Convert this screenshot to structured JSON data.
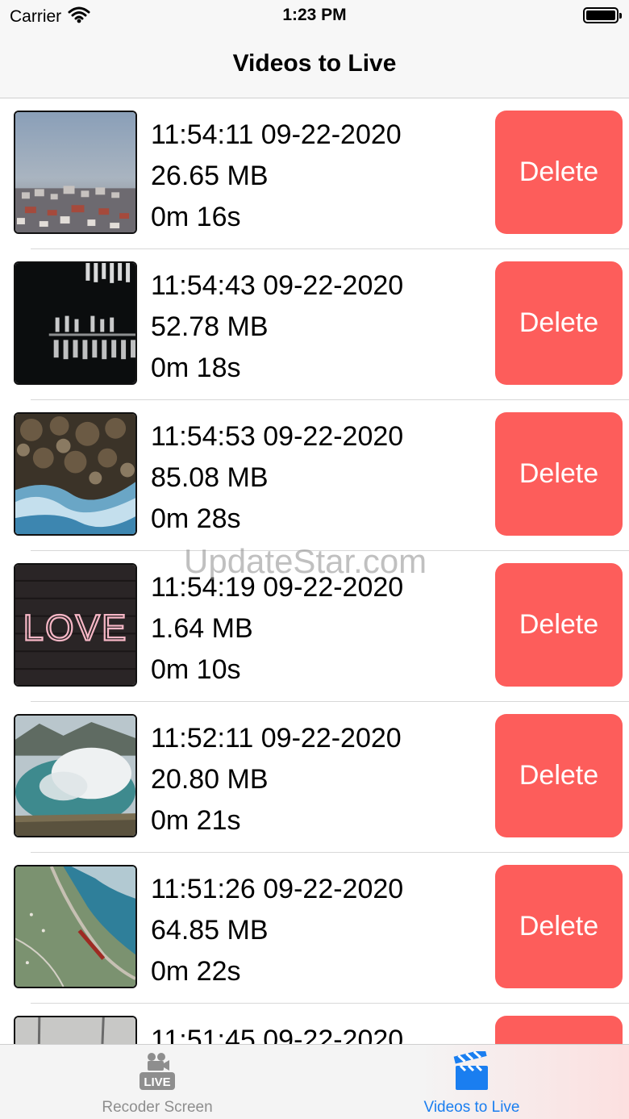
{
  "status": {
    "carrier": "Carrier",
    "time": "1:23 PM",
    "icons": [
      "wifi-icon",
      "battery-icon"
    ]
  },
  "nav": {
    "title": "Videos to Live"
  },
  "videos": [
    {
      "datetime": "11:54:11 09-22-2020",
      "size": "26.65 MB",
      "duration": "0m 16s",
      "thumbnail": "foggy-town"
    },
    {
      "datetime": "11:54:43 09-22-2020",
      "size": "52.78 MB",
      "duration": "0m 18s",
      "thumbnail": "boats-aerial"
    },
    {
      "datetime": "11:54:53 09-22-2020",
      "size": "85.08 MB",
      "duration": "0m 28s",
      "thumbnail": "rocky-shore"
    },
    {
      "datetime": "11:54:19 09-22-2020",
      "size": "1.64 MB",
      "duration": "0m 10s",
      "thumbnail": "love-neon"
    },
    {
      "datetime": "11:52:11 09-22-2020",
      "size": "20.80 MB",
      "duration": "0m 21s",
      "thumbnail": "crater-lake"
    },
    {
      "datetime": "11:51:26 09-22-2020",
      "size": "64.85 MB",
      "duration": "0m 22s",
      "thumbnail": "mountain-railway"
    },
    {
      "datetime": "11:51:45 09-22-2020",
      "size": "",
      "duration": "",
      "thumbnail": "partial"
    }
  ],
  "delete_label": "Delete",
  "love_text": "LOVE",
  "watermark": "UpdateStar.com",
  "tabs": [
    {
      "label": "Recoder Screen",
      "icon": "live-camera-icon",
      "badge": "LIVE",
      "selected": false
    },
    {
      "label": "Videos to Live",
      "icon": "clapperboard-icon",
      "selected": true
    }
  ],
  "colors": {
    "delete": "#fd5d5b",
    "tab_selected": "#1a7ef0",
    "tab_unselected": "#8e8e8e"
  }
}
